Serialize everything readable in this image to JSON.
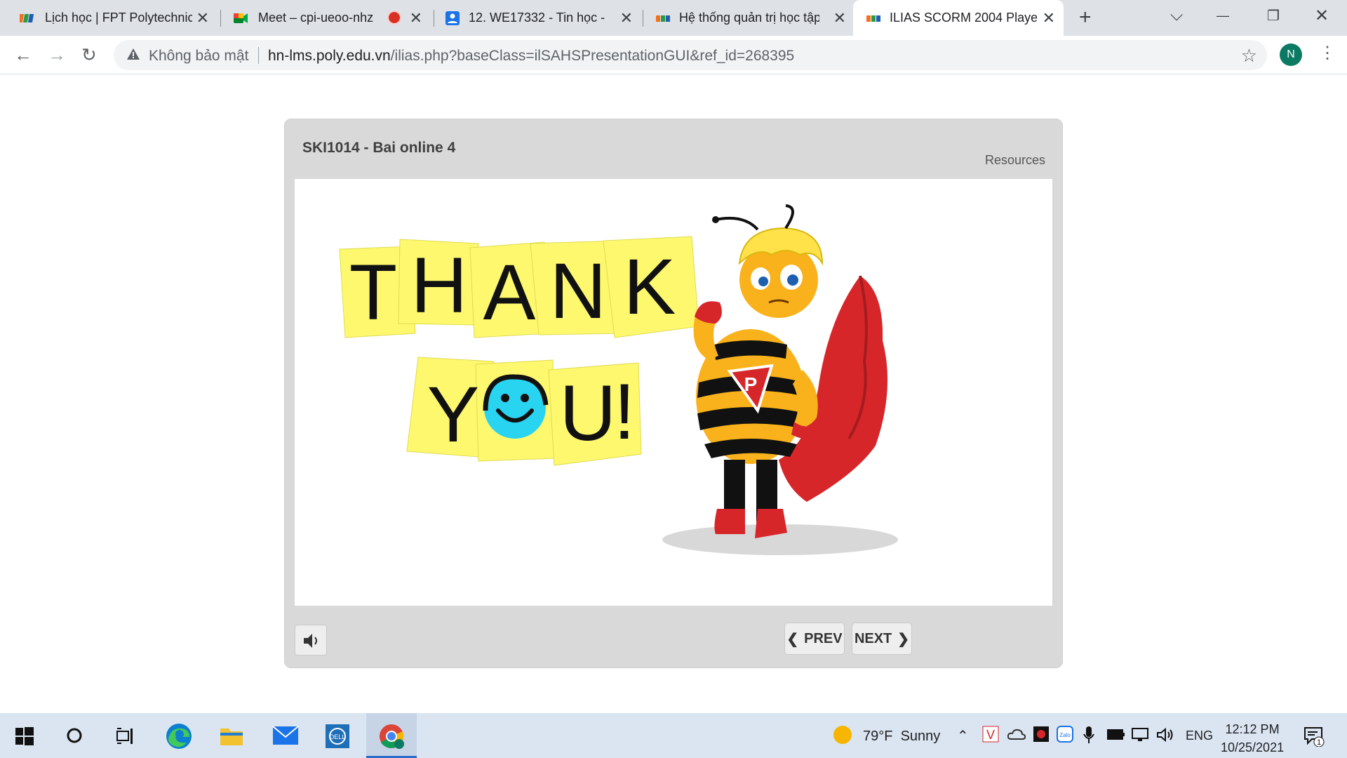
{
  "browser": {
    "tabs": [
      {
        "title": "Lịch học | FPT Polytechnic",
        "close": "✕",
        "active": false
      },
      {
        "title": "Meet – cpi-ueoo-nhz",
        "close": "✕",
        "active": false
      },
      {
        "title": "12. WE17332 - Tin học - C",
        "close": "✕",
        "active": false
      },
      {
        "title": "Hệ thống quản trị học tập",
        "close": "✕",
        "active": false
      },
      {
        "title": "ILIAS SCORM 2004 Player",
        "close": "✕",
        "active": true
      }
    ],
    "new_tab": "+",
    "window_controls": {
      "tabsearch": "⌵",
      "minimize": "—",
      "restore": "❐",
      "close": "✕"
    },
    "toolbar": {
      "back": "←",
      "forward": "→",
      "reload": "↻",
      "security_label": "Không bảo mật",
      "url_host": "hn-lms.poly.edu.vn",
      "url_path": "/ilias.php?baseClass=ilSAHSPresentationGUI&ref_id=268395",
      "profile_initial": "N",
      "menu": "⋮",
      "bookmark": "☆"
    }
  },
  "player": {
    "title": "SKI1014 - Bai online 4",
    "resources_label": "Resources",
    "slide": {
      "line1_letters": [
        "T",
        "H",
        "A",
        "N",
        "K"
      ],
      "line2_letters": [
        "Y",
        "",
        "U",
        "!"
      ]
    },
    "prev_label": "PREV",
    "next_label": "NEXT",
    "colors": {
      "frame": "#d9d9d9",
      "note": "#fdf86e",
      "smiley": "#29d4f0",
      "bee_yellow": "#f9b21b",
      "cape": "#d6262a"
    }
  },
  "taskbar": {
    "weather_temp": "79°F",
    "weather_text": "Sunny",
    "language": "ENG",
    "time": "12:12 PM",
    "date": "10/25/2021",
    "notification_count": "1",
    "icons": [
      "windows-start-icon",
      "search-circle-icon",
      "task-view-icon",
      "edge-icon",
      "file-explorer-icon",
      "mail-icon",
      "dell-icon",
      "chrome-icon"
    ]
  }
}
